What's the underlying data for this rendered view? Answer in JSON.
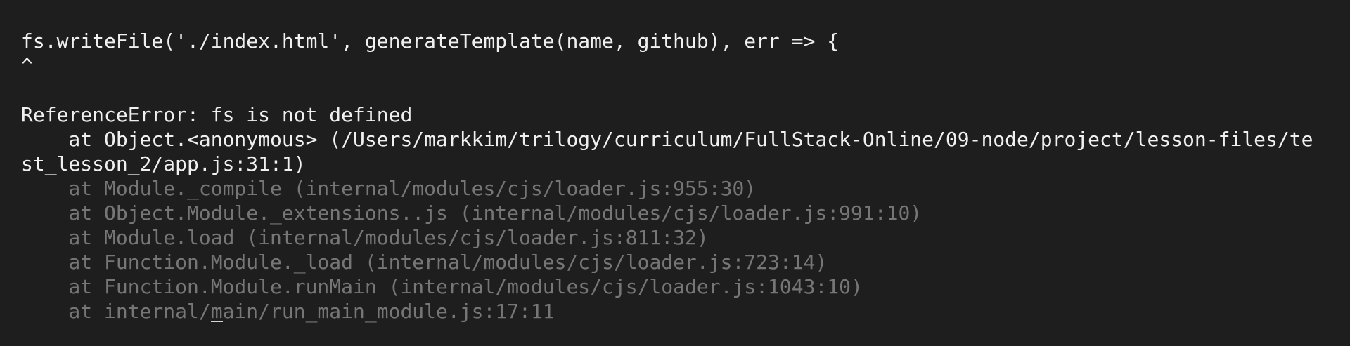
{
  "terminal": {
    "source_line": "fs.writeFile('./index.html', generateTemplate(name, github), err => {",
    "caret": "^",
    "error_message": "ReferenceError: fs is not defined",
    "stack_first": "    at Object.<anonymous> (/Users/markkim/trilogy/curriculum/FullStack-Online/09-node/project/lesson-files/te",
    "stack_first_wrap": "st_lesson_2/app.js:31:1)",
    "stack_internal": [
      "    at Module._compile (internal/modules/cjs/loader.js:955:30)",
      "    at Object.Module._extensions..js (internal/modules/cjs/loader.js:991:10)",
      "    at Module.load (internal/modules/cjs/loader.js:811:32)",
      "    at Function.Module._load (internal/modules/cjs/loader.js:723:14)",
      "    at Function.Module.runMain (internal/modules/cjs/loader.js:1043:10)",
      "    at internal/main/run_main_module.js:17:11"
    ]
  },
  "colors": {
    "background": "#1e1e1e",
    "text_primary": "#f0f0f0",
    "text_dimmed": "#767676"
  }
}
